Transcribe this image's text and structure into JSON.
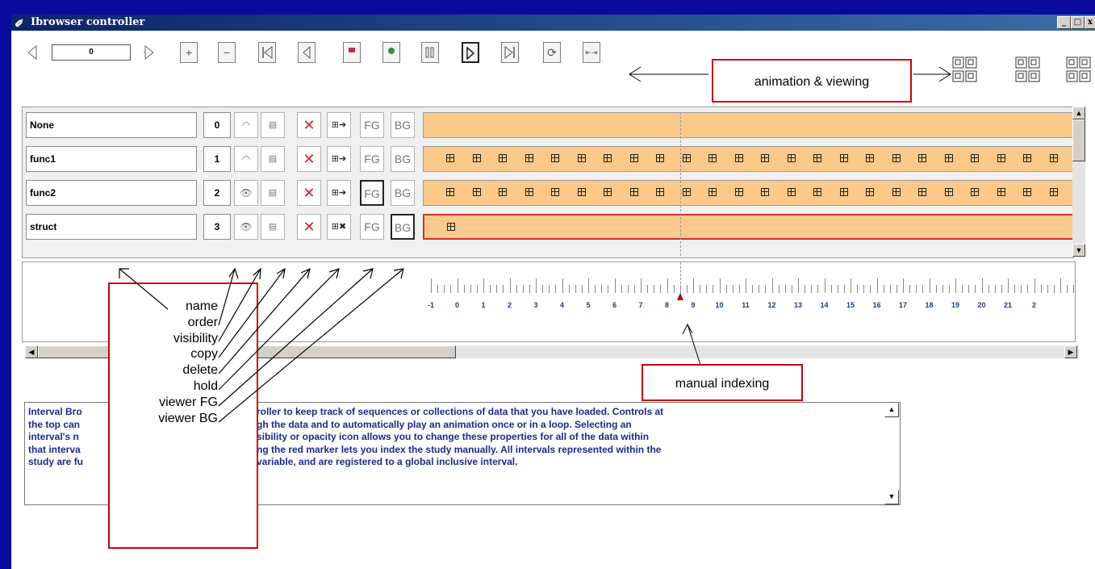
{
  "window": {
    "title": "Ibrowser controller",
    "controls": [
      "_",
      "□",
      "x"
    ]
  },
  "toolbar": {
    "frame_value": "0",
    "buttons": [
      "prev",
      "next",
      "add",
      "remove",
      "first",
      "step-back",
      "stop",
      "record",
      "pause",
      "play",
      "last",
      "loop",
      "fit"
    ]
  },
  "callouts": {
    "animation": "animation  & viewing",
    "indexing": "manual indexing"
  },
  "rows": [
    {
      "name": "None",
      "order": "0",
      "icons": 0,
      "selected": false
    },
    {
      "name": "func1",
      "order": "1",
      "icons": 25,
      "selected": false
    },
    {
      "name": "func2",
      "order": "2",
      "icons": 25,
      "selected": false
    },
    {
      "name": "struct",
      "order": "3",
      "icons": 1,
      "selected": true
    }
  ],
  "column_buttons": {
    "fg": "FG",
    "bg": "BG"
  },
  "ruler": {
    "ticks": [
      "-1",
      "0",
      "1",
      "2",
      "3",
      "4",
      "5",
      "6",
      "7",
      "8",
      "9",
      "10",
      "11",
      "12",
      "13",
      "14",
      "15",
      "16",
      "17",
      "18",
      "19",
      "20",
      "21",
      "2"
    ],
    "marker_index": 8
  },
  "legend_labels": [
    "name",
    "order",
    "visibility",
    "copy",
    "delete",
    "hold",
    "viewer FG",
    "viewer BG"
  ],
  "description": {
    "lines": [
      "Interval Bro",
      "roller to keep track of sequences or collections  of data that you have loaded. Controls at",
      "the top can",
      "gh the data and to automatically play an animation once or in a loop. Selecting an",
      "interval's n",
      "sibility or opacity icon allows  you to change these properties for all of the data within",
      "that interva",
      "ng the red marker lets you index the study manually.  All intervals represented within the",
      "study are fu",
      "variable, and are registered to a global inclusive interval."
    ]
  },
  "colors": {
    "track": "#fbc98a",
    "accent_red": "#d00000",
    "desc_text": "#1a2a8a",
    "desktop": "#0a0a9e"
  }
}
